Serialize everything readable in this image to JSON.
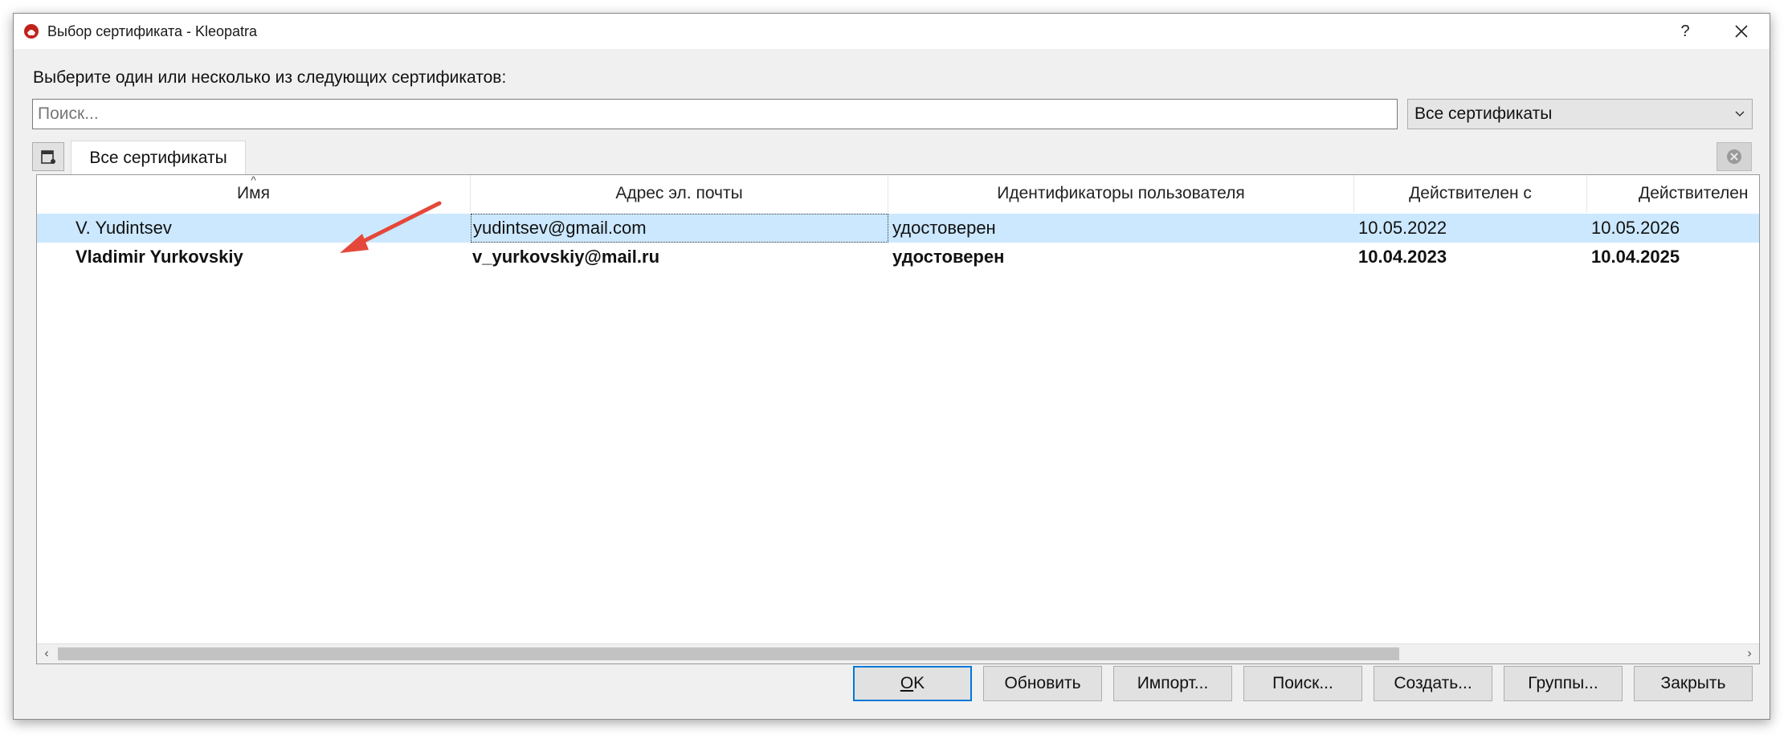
{
  "window": {
    "title": "Выбор сертификата - Kleopatra",
    "help_label": "?",
    "close_label": "✕"
  },
  "prompt": "Выберите один или несколько из следующих сертификатов:",
  "search": {
    "placeholder": "Поиск...",
    "value": ""
  },
  "filter": {
    "selected": "Все сертификаты"
  },
  "tabs": [
    {
      "label": "Все сертификаты"
    }
  ],
  "table": {
    "columns": [
      "Имя",
      "Адрес эл. почты",
      "Идентификаторы пользователя",
      "Действителен с",
      "Действителен"
    ],
    "rows": [
      {
        "name": "V. Yudintsev",
        "email": "yudintsev@gmail.com",
        "uid": "удостоверен",
        "valid_from": "10.05.2022",
        "valid_until": "10.05.2026",
        "selected": true,
        "bold": false
      },
      {
        "name": "Vladimir Yurkovskiy",
        "email": "v_yurkovskiy@mail.ru",
        "uid": "удостоверен",
        "valid_from": "10.04.2023",
        "valid_until": "10.04.2025",
        "selected": false,
        "bold": true
      }
    ]
  },
  "buttons": {
    "ok_underline": "O",
    "ok_rest": "K",
    "refresh": "Обновить",
    "import": "Импорт...",
    "lookup": "Поиск...",
    "create": "Создать...",
    "groups": "Группы...",
    "close": "Закрыть"
  },
  "colors": {
    "selection": "#cce8ff",
    "annotation_arrow": "#e5483a",
    "default_button_border": "#0078d7"
  }
}
